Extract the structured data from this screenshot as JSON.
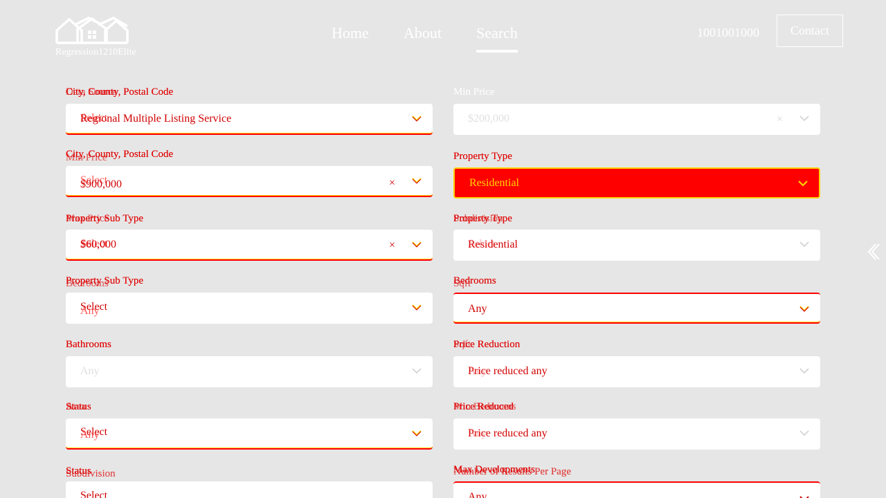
{
  "header": {
    "logo_text": "Regression1210Elite",
    "nav": [
      {
        "label": "Home"
      },
      {
        "label": "About"
      },
      {
        "label": "Search"
      }
    ],
    "phone": "1001001000",
    "contact_label": "Contact"
  },
  "form": {
    "left": [
      {
        "label": "City, County, Postal Code",
        "label_overlap": "Data Source",
        "value": "Regional Multiple Listing Service",
        "value_overlap": "Select"
      },
      {
        "label": "City, County, Postal Code",
        "label_overlap": "Min Price",
        "value": "$900,000",
        "value_overlap": "Select"
      },
      {
        "label": "Property Sub Type",
        "label_overlap": "Max Price",
        "value": "$60,000",
        "value_overlap": "Select"
      },
      {
        "label": "Property Sub Type",
        "label_overlap": "Bedrooms",
        "value": "Select",
        "value_overlap": "Any"
      },
      {
        "label": "Bathrooms",
        "value": "Any"
      },
      {
        "label": "Status",
        "label_overlap": "Area",
        "value": "Select",
        "value_overlap": "Any"
      },
      {
        "label": "Subdivision",
        "label_overlap": "Status",
        "value": "Select"
      }
    ],
    "right": [
      {
        "label": "Min Price",
        "value": "$200,000"
      },
      {
        "label": "Property Type",
        "value": "Residential"
      },
      {
        "label": "Property Type",
        "label_overlap": "Subdivision",
        "value": "Residential",
        "value_overlap": "Select"
      },
      {
        "label": "Bedrooms",
        "label_overlap": "Sqft",
        "value": "Any"
      },
      {
        "label": "Price Reduction",
        "label_overlap": "Sqft",
        "value": "Price reduced any",
        "value_overlap": "Any"
      },
      {
        "label": "Price Reduced",
        "label_overlap": "Min Bedrooms",
        "value": "Price reduced any",
        "value_overlap": "Any"
      },
      {
        "label": "Number of Results Per Page",
        "label_overlap": "Max Developments",
        "value": "Any"
      }
    ]
  }
}
